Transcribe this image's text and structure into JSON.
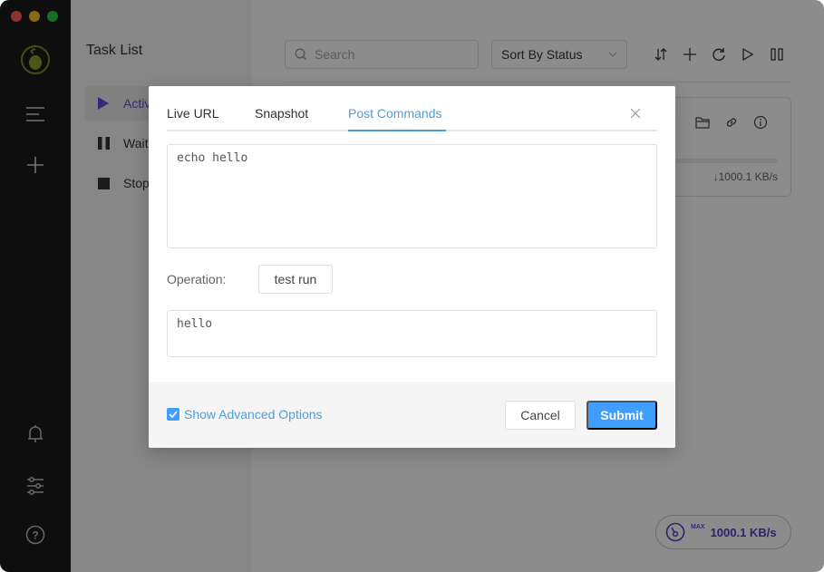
{
  "window": {
    "traffic_lights": [
      "close",
      "minimize",
      "maximize"
    ]
  },
  "rail": {
    "logo_icon": "olive-logo-icon",
    "top_icons": [
      "menu-icon",
      "add-icon"
    ],
    "bottom_icons": [
      "bell-icon",
      "sliders-icon",
      "help-icon"
    ]
  },
  "tasklist": {
    "title": "Task List",
    "items": [
      {
        "label": "Active",
        "icon": "play-icon",
        "active": true
      },
      {
        "label": "Waiting",
        "icon": "pause-icon",
        "active": false
      },
      {
        "label": "Stopped",
        "icon": "stop-icon",
        "active": false
      }
    ]
  },
  "main": {
    "search": {
      "placeholder": "Search",
      "value": ""
    },
    "sort": {
      "selected": "Sort By Status"
    },
    "toolbar_icons": [
      "sort-icon",
      "add-icon",
      "refresh-icon",
      "play-icon",
      "pause-icon"
    ],
    "task_card": {
      "action_icons": [
        "folder-icon",
        "link-icon",
        "info-icon"
      ],
      "download_speed": "↓1000.1 KB/s"
    },
    "speed_pill": {
      "label": "MAX",
      "value": "1000.1 KB/s"
    }
  },
  "dialog": {
    "tabs": [
      {
        "label": "Live URL",
        "active": false
      },
      {
        "label": "Snapshot",
        "active": false
      },
      {
        "label": "Post Commands",
        "active": true
      }
    ],
    "command_text": "echo hello",
    "operation_label": "Operation:",
    "test_run_label": "test run",
    "output_text": "hello",
    "show_advanced_label": "Show Advanced Options",
    "show_advanced_checked": true,
    "cancel_label": "Cancel",
    "submit_label": "Submit"
  },
  "colors": {
    "accent_blue": "#409eff",
    "tab_active": "#4a9fdd",
    "active_item": "#5b4fe0",
    "rail_bg": "#1a1a1a"
  }
}
